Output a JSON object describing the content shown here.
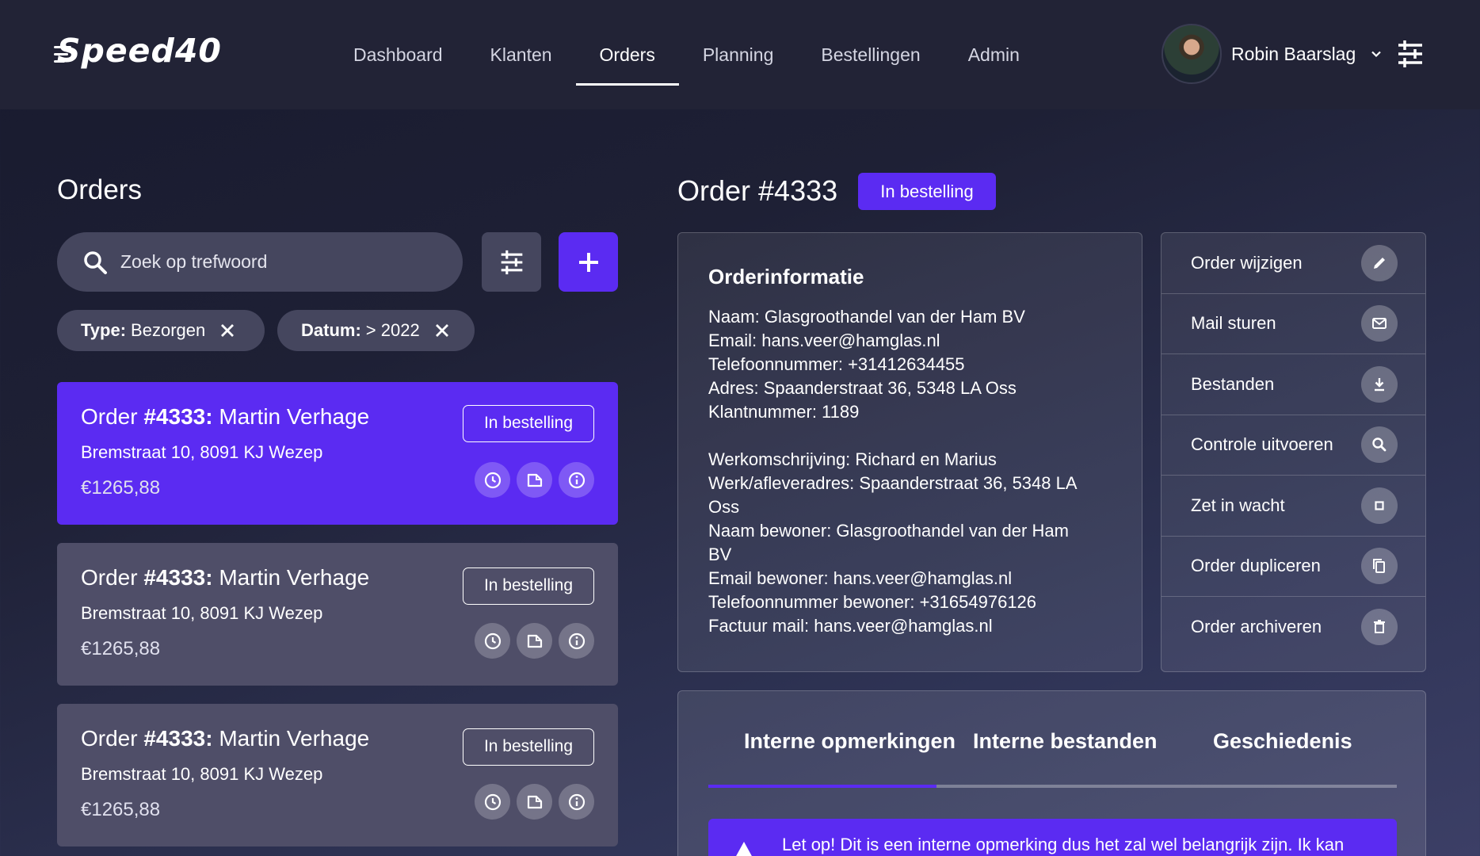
{
  "brand": {
    "logo_text": "Speed40"
  },
  "nav": {
    "items": [
      {
        "label": "Dashboard",
        "active": false
      },
      {
        "label": "Klanten",
        "active": false
      },
      {
        "label": "Orders",
        "active": true
      },
      {
        "label": "Planning",
        "active": false
      },
      {
        "label": "Bestellingen",
        "active": false
      },
      {
        "label": "Admin",
        "active": false
      }
    ]
  },
  "user": {
    "name": "Robin Baarslag"
  },
  "orders_list": {
    "title": "Orders",
    "search": {
      "placeholder": "Zoek op trefwoord"
    },
    "filters": [
      {
        "key": "Type:",
        "value": "Bezorgen"
      },
      {
        "key": "Datum:",
        "value": "> 2022"
      }
    ],
    "orders": [
      {
        "prefix": "Order ",
        "number": "#4333:",
        "customer": "Martin Verhage",
        "address": "Bremstraat 10, 8091 KJ Wezep",
        "price": "€1265,88",
        "status": "In bestelling",
        "selected": true
      },
      {
        "prefix": "Order ",
        "number": "#4333:",
        "customer": "Martin Verhage",
        "address": "Bremstraat 10, 8091 KJ Wezep",
        "price": "€1265,88",
        "status": "In bestelling",
        "selected": false
      },
      {
        "prefix": "Order ",
        "number": "#4333:",
        "customer": "Martin Verhage",
        "address": "Bremstraat 10, 8091 KJ Wezep",
        "price": "€1265,88",
        "status": "In bestelling",
        "selected": false
      }
    ]
  },
  "detail": {
    "title": "Order #4333",
    "status": "In bestelling",
    "info": {
      "heading": "Orderinformatie",
      "lines_top": [
        "Naam: Glasgroothandel van der Ham BV",
        "Email: hans.veer@hamglas.nl",
        "Telefoonnummer: +31412634455",
        "Adres: Spaanderstraat 36, 5348 LA Oss",
        "Klantnummer: 1189"
      ],
      "lines_bottom": [
        "Werkomschrijving: Richard en Marius",
        "Werk/afleveradres: Spaanderstraat 36, 5348 LA",
        "Oss",
        "Naam bewoner: Glasgroothandel van der Ham",
        "BV",
        "Email bewoner: hans.veer@hamglas.nl",
        "Telefoonnummer bewoner: +31654976126",
        "Factuur mail: hans.veer@hamglas.nl"
      ]
    },
    "actions": [
      {
        "label": "Order wijzigen",
        "icon": "pencil-icon"
      },
      {
        "label": "Mail sturen",
        "icon": "mail-icon"
      },
      {
        "label": "Bestanden",
        "icon": "download-icon"
      },
      {
        "label": "Controle uitvoeren",
        "icon": "search-icon"
      },
      {
        "label": "Zet in wacht",
        "icon": "stop-icon"
      },
      {
        "label": "Order dupliceren",
        "icon": "copy-icon"
      },
      {
        "label": "Order archiveren",
        "icon": "trash-icon"
      }
    ],
    "tabs": [
      {
        "label": "Interne opmerkingen",
        "active": true
      },
      {
        "label": "Interne bestanden",
        "active": false
      },
      {
        "label": "Geschiedenis",
        "active": false
      }
    ],
    "note": {
      "text": "Let op! Dit is een interne opmerking dus het zal wel belangrijk zijn. Ik kan"
    }
  },
  "colors": {
    "accent": "#5b2bf2",
    "header": "#222336",
    "chip": "#45465e"
  }
}
